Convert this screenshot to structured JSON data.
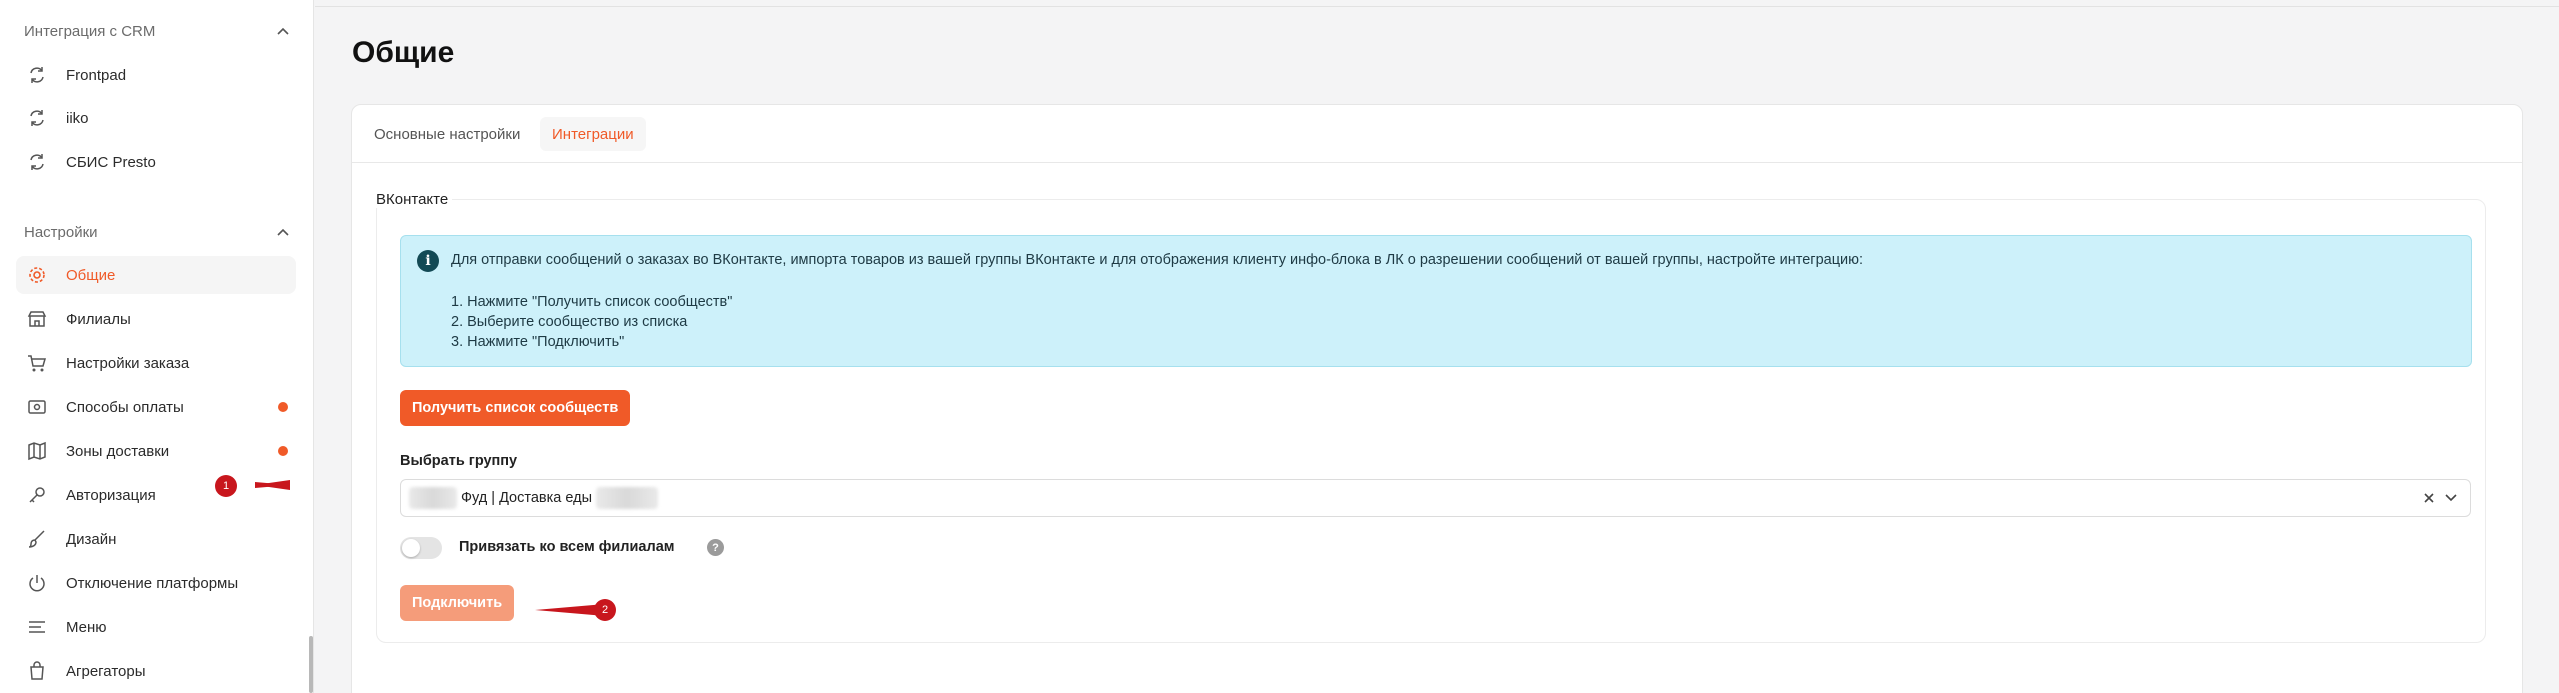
{
  "sidebar": {
    "crm_section": {
      "title": "Интеграция с CRM",
      "items": [
        {
          "label": "Frontpad",
          "icon": "sync-icon"
        },
        {
          "label": "iiko",
          "icon": "sync-icon"
        },
        {
          "label": "СБИС Presto",
          "icon": "sync-icon"
        }
      ]
    },
    "settings_section": {
      "title": "Настройки",
      "items": [
        {
          "label": "Общие",
          "icon": "gear-icon",
          "active": true
        },
        {
          "label": "Филиалы",
          "icon": "store-icon"
        },
        {
          "label": "Настройки заказа",
          "icon": "cart-icon"
        },
        {
          "label": "Способы оплаты",
          "icon": "payment-icon",
          "badge": true
        },
        {
          "label": "Зоны доставки",
          "icon": "map-icon",
          "badge": true
        },
        {
          "label": "Авторизация",
          "icon": "key-icon"
        },
        {
          "label": "Дизайн",
          "icon": "brush-icon"
        },
        {
          "label": "Отключение платформы",
          "icon": "power-icon"
        },
        {
          "label": "Меню",
          "icon": "menu-icon"
        },
        {
          "label": "Агрегаторы",
          "icon": "bag-icon"
        }
      ]
    }
  },
  "page": {
    "title": "Общие",
    "tabs": [
      {
        "label": "Основные настройки",
        "active": false
      },
      {
        "label": "Интеграции",
        "active": true
      }
    ]
  },
  "vk": {
    "legend": "ВКонтакте",
    "info_text": "Для отправки сообщений о заказах во ВКонтакте, импорта товаров из вашей группы ВКонтакте и для отображения клиенту инфо-блока в ЛК о разрешении сообщений от вашей группы, настройте интеграцию:",
    "steps": [
      "1. Нажмите \"Получить список сообществ\"",
      "2. Выберите сообщество из списка",
      "3. Нажмите \"Подключить\""
    ],
    "get_button": "Получить список сообществ",
    "group_label": "Выбрать группу",
    "group_value": "Фуд | Доставка еды",
    "toggle_label": "Привязать ко всем филиалам",
    "toggle_on": false,
    "help": "?",
    "connect_button": "Подключить"
  },
  "annotations": [
    {
      "num": "1"
    },
    {
      "num": "2"
    }
  ],
  "colors": {
    "accent": "#f05a28",
    "accent_disabled": "#f59c7a",
    "info_bg": "#cdf1fa",
    "marker": "#c8161d"
  }
}
